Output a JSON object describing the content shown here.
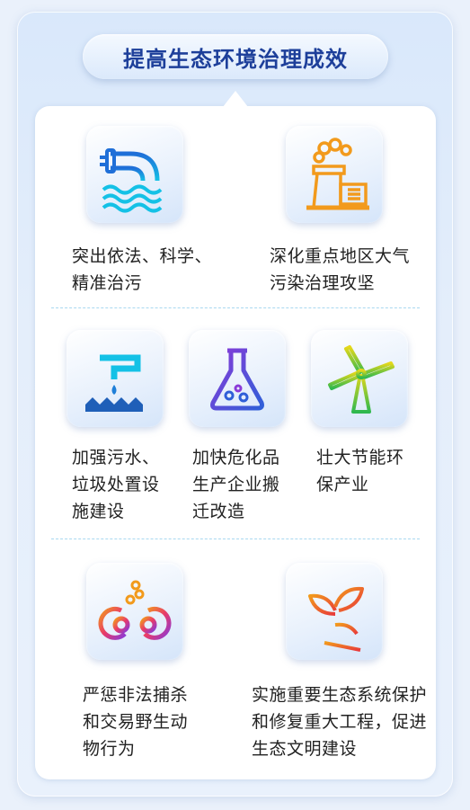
{
  "title": "提高生态环境治理成效",
  "items": [
    {
      "icon": "pipe-water-icon",
      "lines": [
        "突出依法、科学、",
        "精准治污"
      ]
    },
    {
      "icon": "factory-smoke-icon",
      "lines": [
        "深化重点地区大气",
        "污染治理攻坚"
      ]
    },
    {
      "icon": "faucet-water-icon",
      "lines": [
        "加强污水、",
        "垃圾处置设",
        "施建设"
      ]
    },
    {
      "icon": "flask-icon",
      "lines": [
        "加快危化品",
        "生产企业搬",
        "迁改造"
      ]
    },
    {
      "icon": "wind-turbine-icon",
      "lines": [
        "壮大节能环",
        "保产业"
      ]
    },
    {
      "icon": "handcuffs-icon",
      "lines": [
        "严惩非法捕杀",
        "和交易野生动",
        "物行为"
      ]
    },
    {
      "icon": "sprout-icon",
      "lines": [
        "实施重要生态系统保护",
        "和修复重大工程，促进",
        "生态文明建设"
      ]
    }
  ],
  "colors": {
    "title": "#1d3f9a",
    "cyan": "#14c1e6",
    "blue": "#1f7fd8",
    "orange": "#f29a1c",
    "purple": "#8a3ad8",
    "green": "#2fb84f",
    "red": "#e83a3a"
  }
}
